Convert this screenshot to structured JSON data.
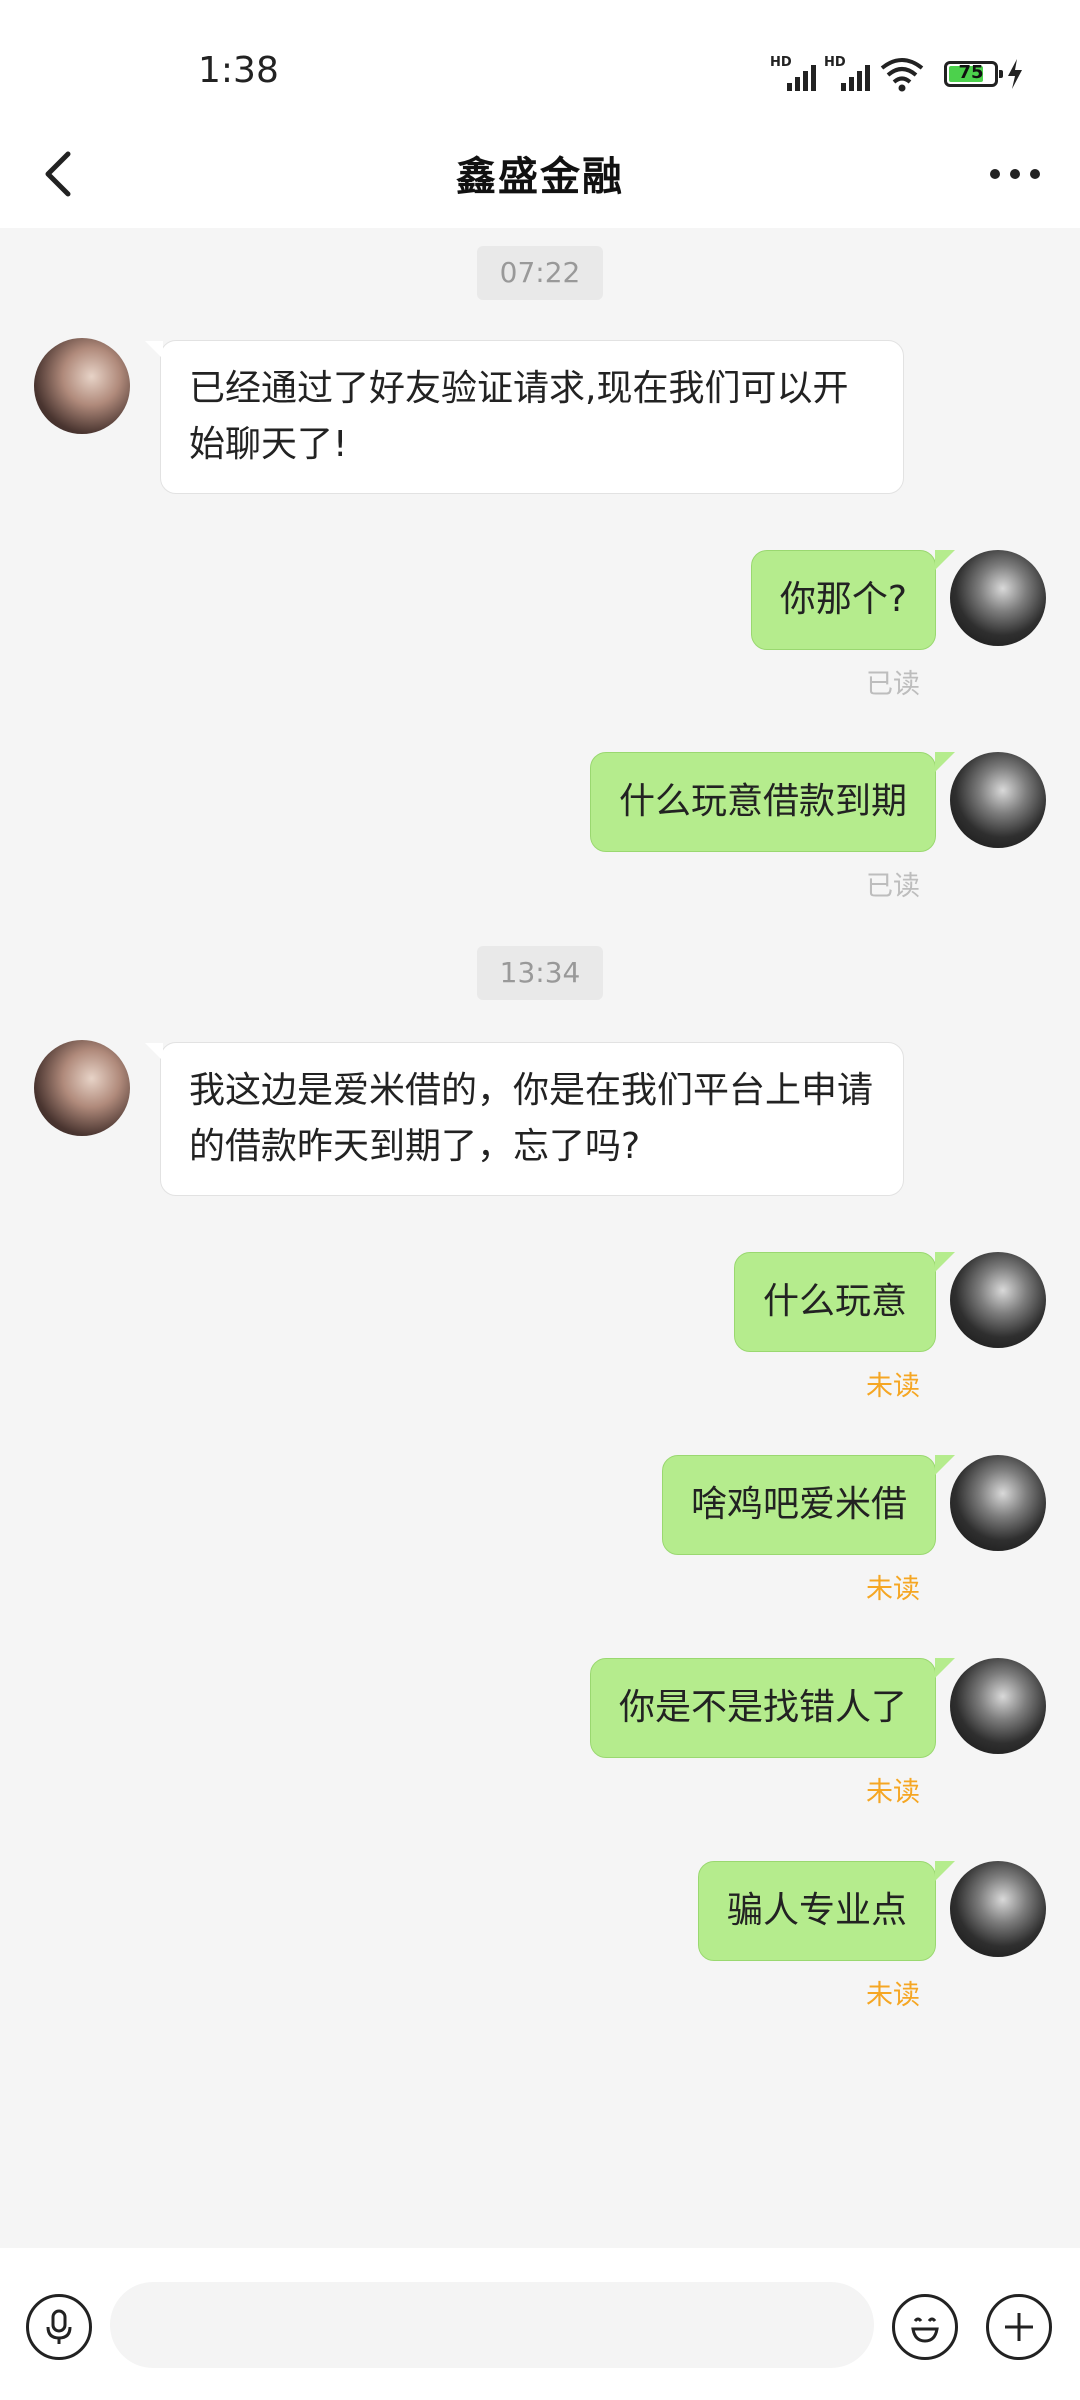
{
  "status_bar": {
    "time": "1:38",
    "signal1_label": "HD",
    "signal2_label": "HD",
    "battery": "75",
    "icons": [
      "signal-icon",
      "signal-icon",
      "wifi-icon",
      "battery-icon",
      "charging-icon"
    ]
  },
  "header": {
    "title": "鑫盛金融",
    "back_icon": "chevron-left-icon",
    "more_icon": "more-horizontal-icon"
  },
  "chat": {
    "timestamps": [
      "07:22",
      "13:34"
    ],
    "messages": [
      {
        "from": "other",
        "text": "已经通过了好友验证请求,现在我们可以开始聊天了!"
      },
      {
        "from": "me",
        "text": "你那个?",
        "receipt": "已读"
      },
      {
        "from": "me",
        "text": "什么玩意借款到期",
        "receipt": "已读"
      },
      {
        "from": "other",
        "text": "我这边是爱米借的，你是在我们平台上申请的借款昨天到期了，忘了吗?"
      },
      {
        "from": "me",
        "text": "什么玩意",
        "receipt": "未读"
      },
      {
        "from": "me",
        "text": "啥鸡吧爱米借",
        "receipt": "未读"
      },
      {
        "from": "me",
        "text": "你是不是找错人了",
        "receipt": "未读"
      },
      {
        "from": "me",
        "text": "骗人专业点",
        "receipt": "未读"
      }
    ]
  },
  "input_bar": {
    "placeholder": "",
    "icons": [
      "microphone-icon",
      "emoji-icon",
      "plus-icon"
    ]
  },
  "colors": {
    "outgoing_bubble": "#b5ec8d",
    "incoming_bubble": "#ffffff",
    "unread": "#f5a623",
    "read": "#bdbdbd"
  }
}
